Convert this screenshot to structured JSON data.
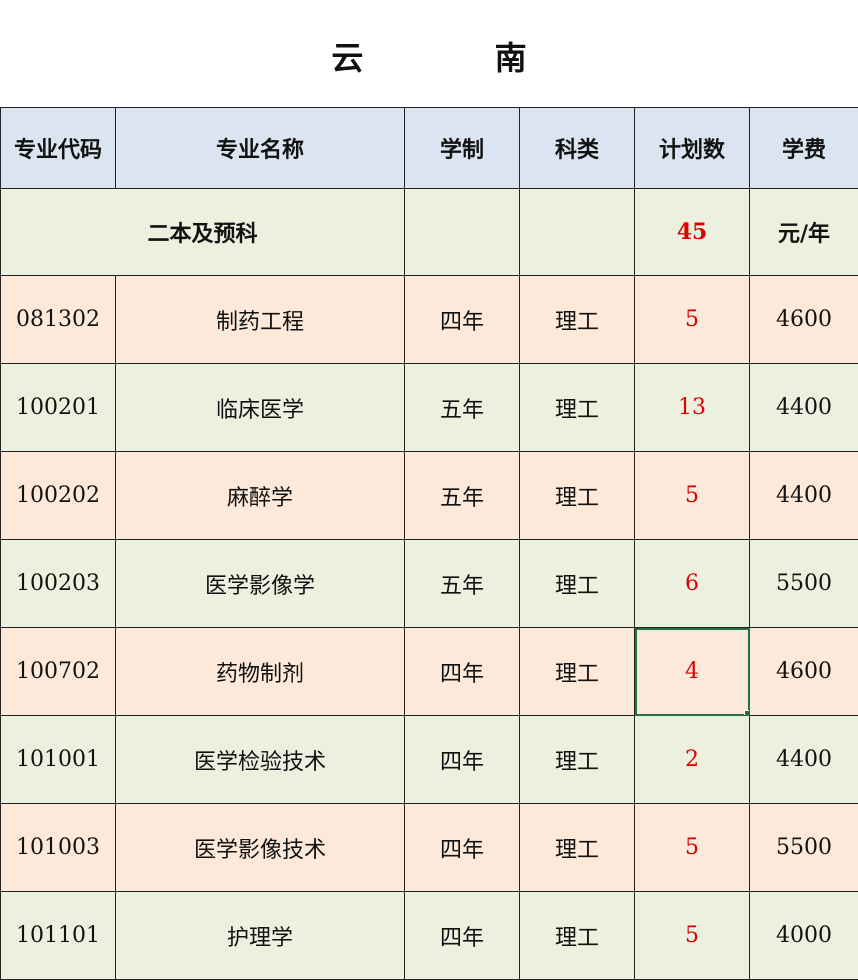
{
  "title": "云 南",
  "headers": {
    "code": "专业代码",
    "name": "专业名称",
    "years": "学制",
    "category": "科类",
    "plan": "计划数",
    "fee": "学费"
  },
  "group": {
    "label": "二本及预科",
    "plan": "45",
    "fee_unit": "元/年"
  },
  "rows": [
    {
      "code": "081302",
      "name": "制药工程",
      "years": "四年",
      "category": "理工",
      "plan": "5",
      "fee": "4600"
    },
    {
      "code": "100201",
      "name": "临床医学",
      "years": "五年",
      "category": "理工",
      "plan": "13",
      "fee": "4400"
    },
    {
      "code": "100202",
      "name": "麻醉学",
      "years": "五年",
      "category": "理工",
      "plan": "5",
      "fee": "4400"
    },
    {
      "code": "100203",
      "name": "医学影像学",
      "years": "五年",
      "category": "理工",
      "plan": "6",
      "fee": "5500"
    },
    {
      "code": "100702",
      "name": "药物制剂",
      "years": "四年",
      "category": "理工",
      "plan": "4",
      "fee": "4600"
    },
    {
      "code": "101001",
      "name": "医学检验技术",
      "years": "四年",
      "category": "理工",
      "plan": "2",
      "fee": "4400"
    },
    {
      "code": "101003",
      "name": "医学影像技术",
      "years": "四年",
      "category": "理工",
      "plan": "5",
      "fee": "5500"
    },
    {
      "code": "101101",
      "name": "护理学",
      "years": "四年",
      "category": "理工",
      "plan": "5",
      "fee": "4000"
    }
  ],
  "colors": {
    "header_bg": "#dbe5f1",
    "green_bg": "#ebf1de",
    "peach_bg": "#fde9d9",
    "plan_text": "#e00000",
    "selection": "#217346"
  }
}
